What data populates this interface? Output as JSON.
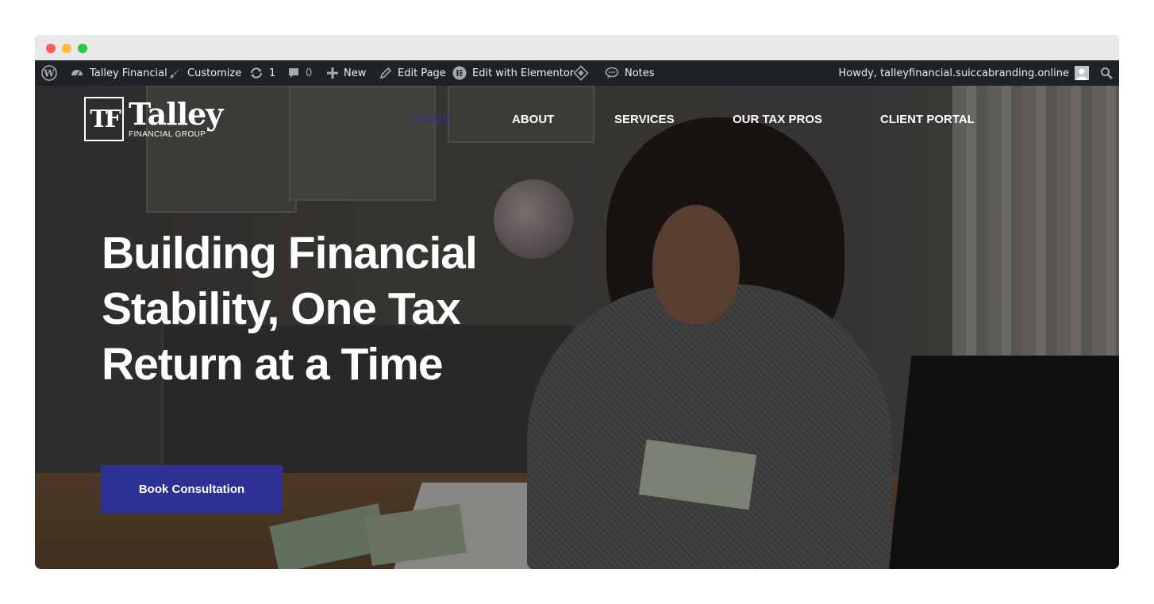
{
  "browser": {
    "controls": [
      "close",
      "minimize",
      "maximize"
    ]
  },
  "adminbar": {
    "wp_logo_icon": "wordpress-icon",
    "site_name": "Talley Financial",
    "customize": "Customize",
    "updates_count": "1",
    "comments_count": "0",
    "new_label": "New",
    "edit_page": "Edit Page",
    "edit_elementor": "Edit with Elementor",
    "notes": "Notes",
    "howdy": "Howdy, talleyfinancial.suiccabranding.online"
  },
  "header": {
    "logo_mark": "TF",
    "logo_name": "Talley",
    "logo_sub": "FINANCIAL GROUP",
    "nav": [
      {
        "label": "HOME",
        "active": true
      },
      {
        "label": "ABOUT",
        "active": false
      },
      {
        "label": "SERVICES",
        "active": false
      },
      {
        "label": "OUR TAX PROS",
        "active": false
      },
      {
        "label": "CLIENT PORTAL",
        "active": false
      }
    ]
  },
  "hero": {
    "headline_line1": "Building Financial",
    "headline_line2": "Stability, One Tax",
    "headline_line3": "Return at a Time",
    "cta_label": "Book Consultation"
  },
  "colors": {
    "accent": "#2e3193",
    "adminbar_bg": "#1d2327",
    "admin_text": "#f0f0f1",
    "titlebar": "#e8e8e8"
  }
}
